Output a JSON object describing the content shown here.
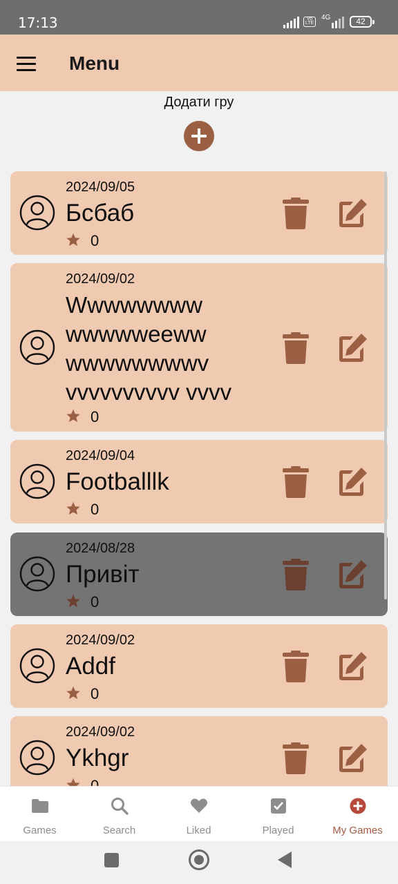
{
  "status_bar": {
    "time": "17:13",
    "network": "4G",
    "volte": "Vo LTE",
    "battery": "42"
  },
  "app_bar": {
    "title": "Menu"
  },
  "add_game": {
    "label": "Додати гру",
    "icon": "plus-circle-icon"
  },
  "games": [
    {
      "date": "2024/09/05",
      "name": "Бсбаб",
      "rating": "0",
      "highlighted": false
    },
    {
      "date": "2024/09/02",
      "name": "Wwwwwwww wwwwweeww wwwwwwwwv vvvvvvvvvv vvvv",
      "rating": "0",
      "highlighted": false
    },
    {
      "date": "2024/09/04",
      "name": "Footballlk",
      "rating": "0",
      "highlighted": false
    },
    {
      "date": "2024/08/28",
      "name": "Привіт",
      "rating": "0",
      "highlighted": true
    },
    {
      "date": "2024/09/02",
      "name": "Addf",
      "rating": "0",
      "highlighted": false
    },
    {
      "date": "2024/09/02",
      "name": "Ykhgr",
      "rating": "0",
      "highlighted": false
    }
  ],
  "bottom_nav": [
    {
      "label": "Games",
      "icon": "folder-icon",
      "active": false
    },
    {
      "label": "Search",
      "icon": "search-icon",
      "active": false
    },
    {
      "label": "Liked",
      "icon": "heart-icon",
      "active": false
    },
    {
      "label": "Played",
      "icon": "checkbox-icon",
      "active": false
    },
    {
      "label": "My Games",
      "icon": "plus-circle-icon",
      "active": true
    }
  ],
  "colors": {
    "accent": "#9b6043",
    "card": "#efc9b0",
    "card_highlight": "#747474",
    "nav_active": "#a85b42",
    "app_bar": "#efc9b0"
  }
}
